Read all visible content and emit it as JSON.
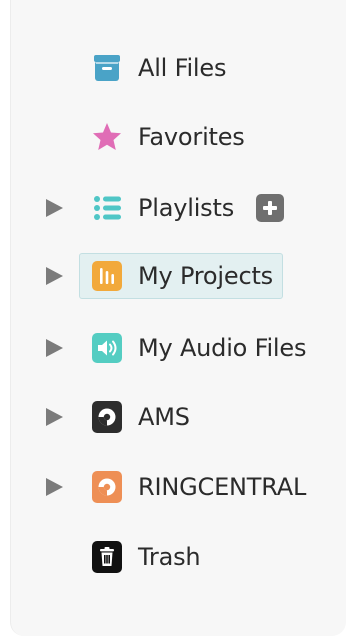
{
  "tree": {
    "items": [
      {
        "label": "All Files",
        "icon": "archive-box-icon",
        "color": "#4aa3c7",
        "expandable": false
      },
      {
        "label": "Favorites",
        "icon": "star-icon",
        "color": "#e06db6",
        "expandable": false
      },
      {
        "label": "Playlists",
        "icon": "list-icon",
        "color": "#4fc6c6",
        "expandable": true,
        "has_add_button": true
      },
      {
        "label": "My Projects",
        "icon": "audio-bars-icon",
        "color": "#f2a93b",
        "expandable": true,
        "selected": true
      },
      {
        "label": "My Audio Files",
        "icon": "speaker-icon",
        "color": "#54cdc2",
        "expandable": true
      },
      {
        "label": "AMS",
        "icon": "disc-icon",
        "color": "#2d2d2d",
        "expandable": true
      },
      {
        "label": "RINGCENTRAL",
        "icon": "disc-icon",
        "color": "#ee8f55",
        "expandable": true
      },
      {
        "label": "Trash",
        "icon": "trash-icon",
        "color": "#111111",
        "expandable": false
      }
    ]
  },
  "colors": {
    "panel_bg": "#f7f7f7",
    "selected_bg": "#e3f0f1",
    "chevron": "#7b7b7b",
    "text": "#2b2b2b"
  }
}
